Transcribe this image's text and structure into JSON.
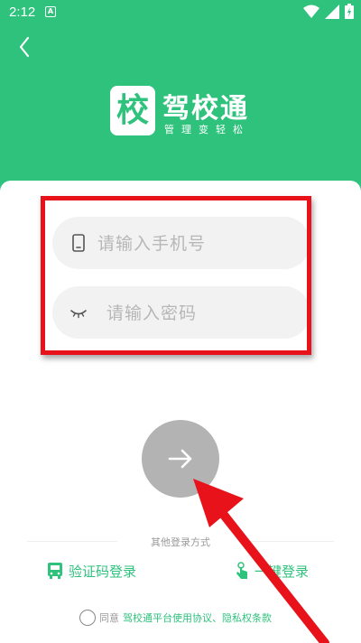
{
  "status_bar": {
    "time": "2:12",
    "notif_letter": "A"
  },
  "brand": {
    "tile_char": "校",
    "name": "驾校通",
    "slogan": "管理变轻松"
  },
  "form": {
    "phone_placeholder": "请输入手机号",
    "password_placeholder": "请输入密码"
  },
  "other": {
    "divider_text": "其他登录方式",
    "sms_label": "验证码登录",
    "onekey_label": "一键登录"
  },
  "agreement": {
    "prefix": "同意",
    "links": "驾校通平台使用协议、隐私权条款"
  },
  "colors": {
    "brand": "#2fc27d",
    "highlight": "#e8131a",
    "button_disabled": "#b3b3b3"
  },
  "icons": [
    "back-icon",
    "wifi-icon",
    "signal-icon",
    "battery-icon",
    "phone-icon",
    "eye-closed-icon",
    "arrow-right-icon",
    "sms-icon",
    "tap-icon"
  ]
}
